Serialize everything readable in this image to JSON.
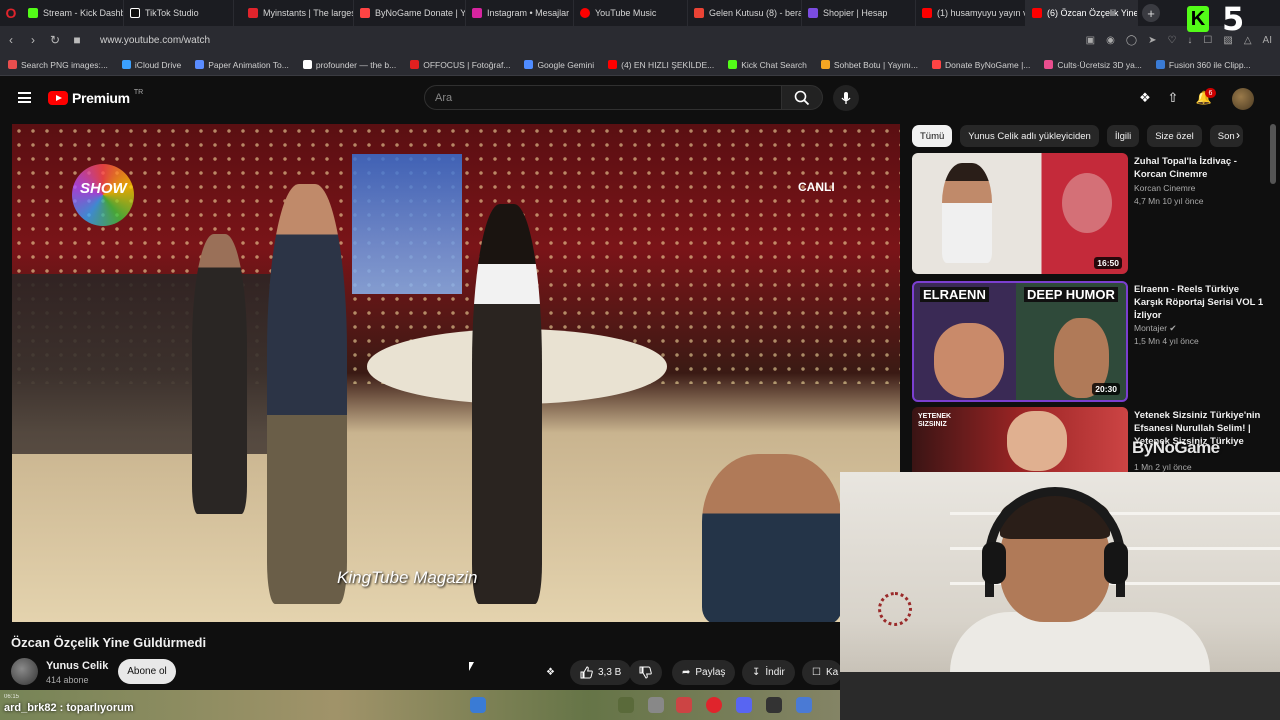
{
  "browser": {
    "tabs": [
      {
        "label": "Stream - Kick Dashboard",
        "color": "#53fc18"
      },
      {
        "label": "TikTok Studio",
        "color": "#ffffff"
      },
      {
        "label": "Myinstants | The largest",
        "color": "#e0242c"
      },
      {
        "label": "ByNoGame Donate | Yay",
        "color": "#ff4444"
      },
      {
        "label": "Instagram • Mesajlar",
        "color": "#d6249f"
      },
      {
        "label": "YouTube Music",
        "color": "#ff0000"
      },
      {
        "label": "Gelen Kutusu (8) - berat",
        "color": "#ea4335"
      },
      {
        "label": "Shopier | Hesap",
        "color": "#7b4ce0"
      },
      {
        "label": "(1) husamyuyu yayın vakt",
        "color": "#ff0000"
      },
      {
        "label": "(6) Özcan Özçelik Yine",
        "color": "#ff0000"
      }
    ],
    "url": "www.youtube.com/watch",
    "bookmarks": [
      {
        "label": "Search PNG images:...",
        "color": "#e94e4e"
      },
      {
        "label": "iCloud Drive",
        "color": "#3ba1ff"
      },
      {
        "label": "Paper Animation To...",
        "color": "#5a8cff"
      },
      {
        "label": "profounder — the b...",
        "color": "#ffffff"
      },
      {
        "label": "OFFOCUS | Fotoğraf...",
        "color": "#e02020"
      },
      {
        "label": "Google Gemini",
        "color": "#4f8cff"
      },
      {
        "label": "(4) EN HIZLI ŞEKİLDE...",
        "color": "#ff0000"
      },
      {
        "label": "Kick Chat Search",
        "color": "#53fc18"
      },
      {
        "label": "Sohbet Botu | Yayını...",
        "color": "#f5a623"
      },
      {
        "label": "Donate ByNoGame |...",
        "color": "#ff4444"
      },
      {
        "label": "Cults·Ücretsiz 3D ya...",
        "color": "#e94e8e"
      },
      {
        "label": "Fusion 360 ile Clipp...",
        "color": "#3a7bd5"
      }
    ]
  },
  "youtube": {
    "premium_label": "Premium",
    "premium_region": "TR",
    "search_placeholder": "Ara",
    "notification_count": "6",
    "video": {
      "title": "Özcan Özçelik Yine Güldürmedi",
      "overlay_show": "SHOW",
      "overlay_live": "CANLI",
      "overlay_watermark": "KingTube Magazin"
    },
    "channel": {
      "name": "Yunus Celik",
      "subscribers": "414 abone",
      "subscribe_label": "Abone ol"
    },
    "actions": {
      "likes": "3,3 B",
      "share": "Paylaş",
      "download": "İndir",
      "save": "Ka"
    },
    "chips": [
      "Tümü",
      "Yunus Celik adlı yükleyiciden",
      "İlgili",
      "Size özel",
      "Son"
    ],
    "recommendations": [
      {
        "title": "Zuhal Topal'la İzdivaç - Korcan Cinemre",
        "channel": "Korcan Cinemre",
        "meta": "4,7 Mn  10 yıl önce",
        "duration": "16:50"
      },
      {
        "title": "Elraenn - Reels Türkiye Karşık Röportaj Serisi VOL 1 İzliyor",
        "channel": "Montajer ✔",
        "meta": "1,5 Mn  4 yıl önce",
        "duration": "20:30",
        "thumb_text_left": "ELRAENN",
        "thumb_text_right": "DEEP HUMOR"
      },
      {
        "title": "Yetenek Sizsiniz Türkiye'nin Efsanesi Nurullah Selim! | Yetenek Sizsiniz Türkiye",
        "channel": "",
        "meta": "1 Mn  2 yıl önce",
        "duration": "",
        "thumb_text_left": "YETENEK SIZSINIZ"
      }
    ]
  },
  "overlays": {
    "kick_badge": "K",
    "kick_number": "5",
    "sponsor": "ByNoGame",
    "chat_time": "06:15",
    "chat_user": "ard_brk82",
    "chat_message": "toparlıyorum"
  }
}
